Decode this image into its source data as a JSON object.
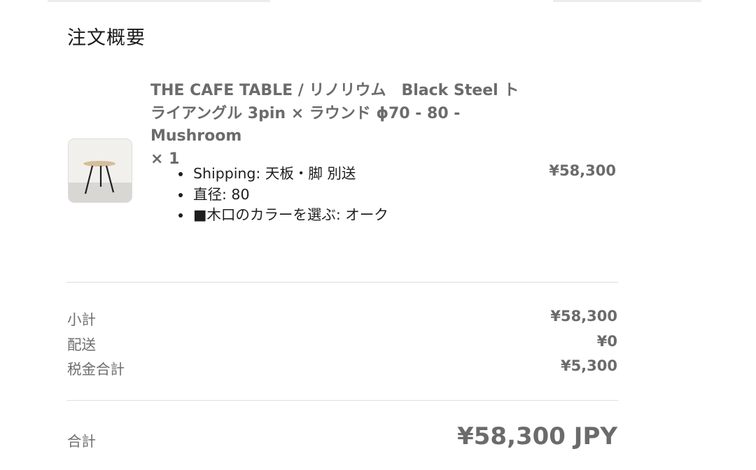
{
  "summary": {
    "title": "注文概要"
  },
  "item": {
    "thumbnail_icon": "cafe-table-photo",
    "name": "THE CAFE TABLE / リノリウム　Black Steel トライアングル 3pin × ラウンド ϕ70 - 80 - Mushroom",
    "quantity": "× 1",
    "options": [
      "Shipping: 天板・脚 別送",
      "直径: 80",
      "■木口のカラーを選ぶ: オーク"
    ],
    "price": "¥58,300"
  },
  "totals": {
    "subtotal_label": "小計",
    "subtotal_value": "¥58,300",
    "shipping_label": "配送",
    "shipping_value": "¥0",
    "tax_label": "税金合計",
    "tax_value": "¥5,300",
    "grand_total_label": "合計",
    "grand_total_value": "¥58,300 JPY"
  }
}
